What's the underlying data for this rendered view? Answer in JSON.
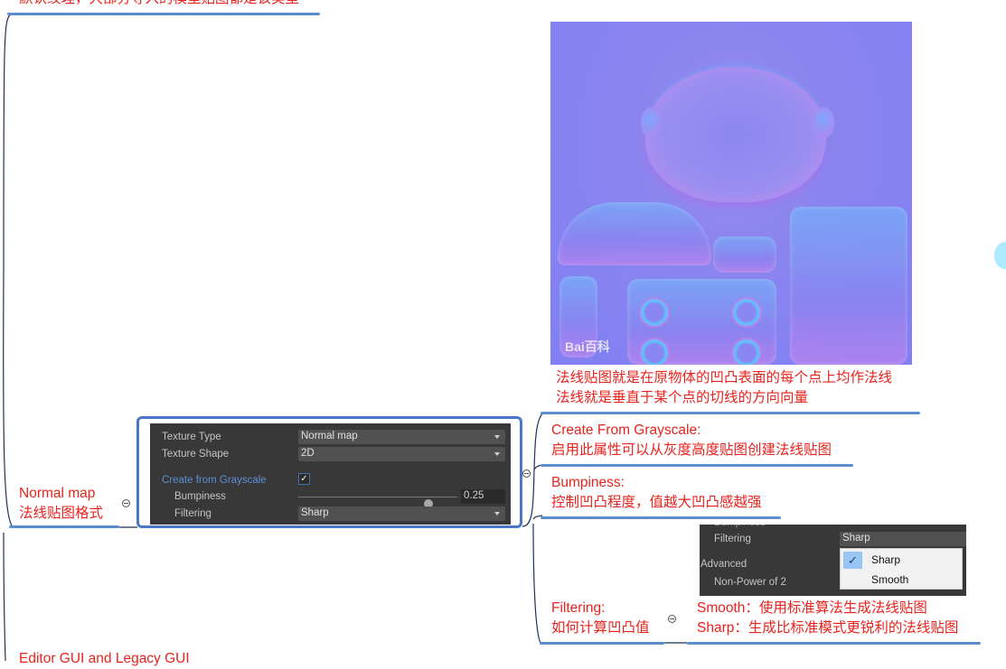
{
  "mindmap": {
    "top_node": {
      "text": "默认纹理，大部分导入的模型贴图都是该类型"
    },
    "normal_map_node": {
      "line1": "Normal map",
      "line2": "法线贴图格式"
    },
    "bottom_node": {
      "text": "Editor GUI and Legacy GUI"
    },
    "image_caption": {
      "line1": "法线贴图就是在原物体的凹凸表面的每个点上均作法线",
      "line2": "法线就是垂直于某个点的切线的方向向量"
    },
    "children": [
      {
        "title": "Create From Grayscale:",
        "desc": "启用此属性可以从灰度高度贴图创建法线贴图"
      },
      {
        "title": "Bumpiness:",
        "desc": "控制凹凸程度，值越大凹凸感越强"
      },
      {
        "title": "Filtering:",
        "desc": "如何计算凹凸值"
      }
    ],
    "filtering_detail": {
      "line1": "Smooth：使用标准算法生成法线贴图",
      "line2": "Sharp：生成比标准模式更锐利的法线贴图"
    },
    "colors": {
      "text_accent": "#e8231d",
      "underline": "#5b8dd0",
      "frame": "#4a76c9"
    }
  },
  "normal_map_image": {
    "watermark": "Bai百科",
    "alt": "normal map texture"
  },
  "inspector": {
    "texture_type_label": "Texture Type",
    "texture_type_value": "Normal map",
    "texture_shape_label": "Texture Shape",
    "texture_shape_value": "2D",
    "create_from_grayscale_label": "Create from Grayscale",
    "create_from_grayscale_checked": true,
    "check_glyph": "✓",
    "bumpiness_label": "Bumpiness",
    "bumpiness_value": "0.25",
    "bumpiness_slider_fraction": 0.82,
    "filtering_label": "Filtering",
    "filtering_value": "Sharp"
  },
  "filtering_popup": {
    "cut_label": "Bumpiness",
    "filtering_label": "Filtering",
    "filtering_value": "Sharp",
    "advanced_label": "Advanced",
    "non_power_label": "Non-Power of 2",
    "options": [
      "Sharp",
      "Smooth"
    ],
    "selected": "Sharp",
    "check_glyph": "✓"
  }
}
